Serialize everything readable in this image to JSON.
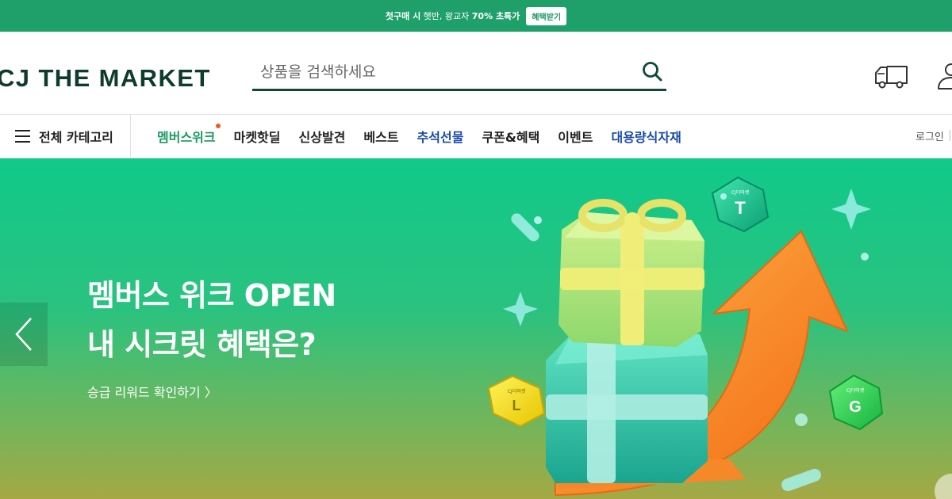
{
  "promo": {
    "text_bold1": "첫구매 시",
    "text_normal": " 햇반, 왕교자 ",
    "text_bold2": "70% 초특가",
    "button_label": "혜택받기"
  },
  "header": {
    "logo": "CJ THE MARKET",
    "search_placeholder": "상품을 검색하세요",
    "icons": [
      "search-icon",
      "delivery-truck-icon",
      "user-icon"
    ]
  },
  "nav": {
    "all_categories_label": "전체 카테고리",
    "menu": [
      {
        "label": "멤버스위크",
        "color": "#1a9a62",
        "badge": true
      },
      {
        "label": "마켓핫딜"
      },
      {
        "label": "신상발견"
      },
      {
        "label": "베스트"
      },
      {
        "label": "추석선물",
        "color": "#1b4aa8"
      },
      {
        "label": "쿠폰&혜택"
      },
      {
        "label": "이벤트"
      },
      {
        "label": "대용량식자재",
        "color": "#1b4aa8"
      }
    ],
    "login_label": "로그인"
  },
  "hero": {
    "title_line1": "멤버스 위크 OPEN",
    "title_line2": "내 시크릿 혜택은?",
    "link_label": "승급 리워드 확인하기 〉",
    "badges": {
      "t": "T",
      "l": "L",
      "g": "G",
      "brand": "CJ더마켓"
    }
  },
  "colors": {
    "brand_green": "#1fa06b",
    "logo_dark": "#0f3b2f",
    "accent_blue": "#1b4aa8",
    "badge_orange": "#f05a28"
  }
}
